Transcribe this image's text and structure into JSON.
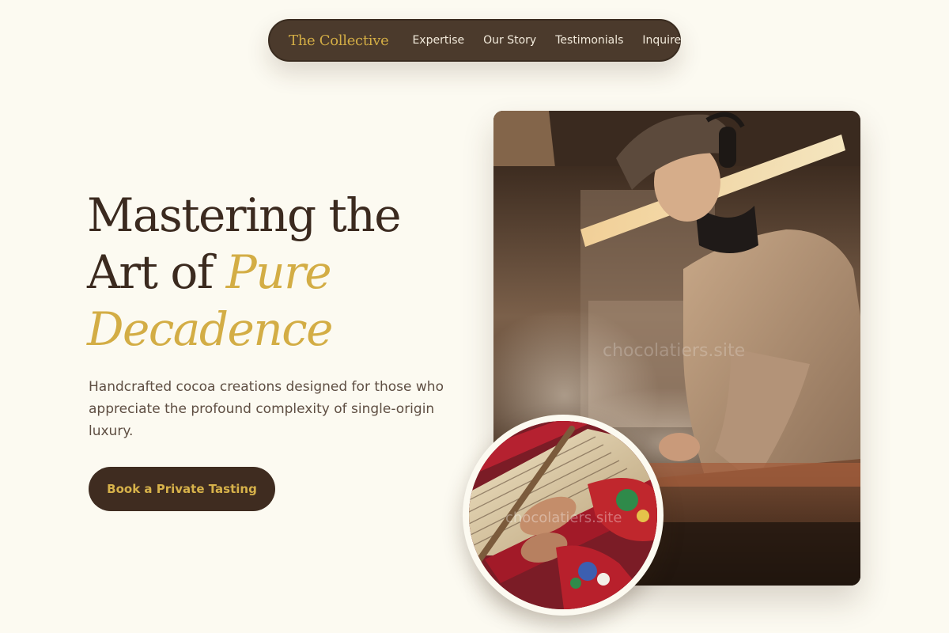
{
  "nav": {
    "brand": "The Collective",
    "links": [
      "Expertise",
      "Our Story",
      "Testimonials",
      "Inquire"
    ]
  },
  "hero": {
    "title_line1": "Mastering the",
    "title_line2_plain": "Art of ",
    "title_line2_accent": "Pure",
    "title_line3_accent": "Decadence",
    "subtitle": "Handcrafted cocoa creations designed for those who appreciate the profound complexity of single-origin luxury.",
    "cta_label": "Book a Private Tasting"
  },
  "images": {
    "watermark": "chocolatiers.site"
  },
  "colors": {
    "background": "#fcfaf1",
    "nav_background": "#4b3a2c",
    "brand_gold": "#d3ad45",
    "heading_brown": "#3b2a1f",
    "cta_background": "#3f2c20"
  }
}
